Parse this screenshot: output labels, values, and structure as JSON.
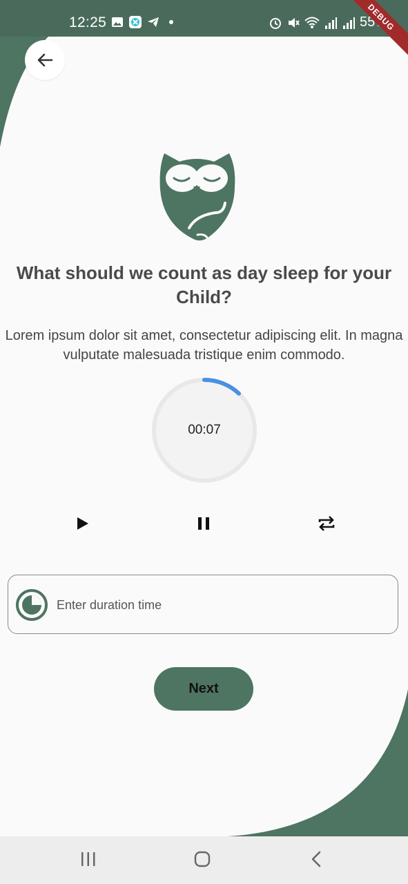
{
  "status_bar": {
    "time": "12:25",
    "battery": "55%",
    "debug_label": "DEBUG"
  },
  "header": {
    "back_icon": "arrow-left-icon"
  },
  "logo": {
    "icon": "sleeping-owl-logo"
  },
  "title": "What should we count as day sleep for your Child?",
  "description": "Lorem ipsum dolor sit amet, consectetur adipiscing elit. In magna vulputate malesuada tristique enim commodo.",
  "timer": {
    "display": "00:07",
    "progress_fraction": 0.12
  },
  "controls": {
    "play_icon": "play-icon",
    "pause_icon": "pause-icon",
    "repeat_icon": "repeat-icon"
  },
  "duration_field": {
    "placeholder": "Enter duration time",
    "value": "",
    "icon": "timer-icon"
  },
  "next_button": {
    "label": "Next"
  },
  "colors": {
    "brand_green": "#4e7462",
    "page_background": "#fafafa",
    "timer_accent": "#4a90e2"
  }
}
